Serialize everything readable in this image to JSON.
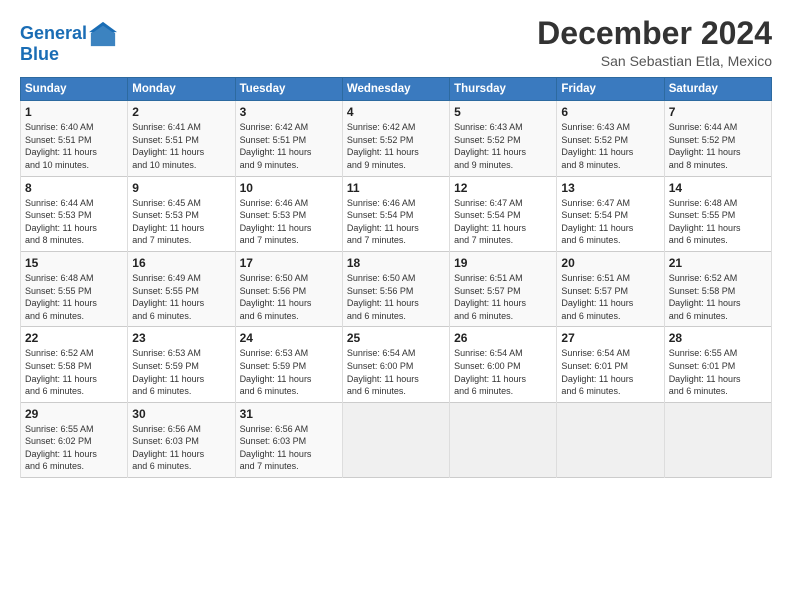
{
  "header": {
    "logo_line1": "General",
    "logo_line2": "Blue",
    "title": "December 2024",
    "location": "San Sebastian Etla, Mexico"
  },
  "weekdays": [
    "Sunday",
    "Monday",
    "Tuesday",
    "Wednesday",
    "Thursday",
    "Friday",
    "Saturday"
  ],
  "weeks": [
    [
      {
        "day": "1",
        "info": "Sunrise: 6:40 AM\nSunset: 5:51 PM\nDaylight: 11 hours\nand 10 minutes."
      },
      {
        "day": "2",
        "info": "Sunrise: 6:41 AM\nSunset: 5:51 PM\nDaylight: 11 hours\nand 10 minutes."
      },
      {
        "day": "3",
        "info": "Sunrise: 6:42 AM\nSunset: 5:51 PM\nDaylight: 11 hours\nand 9 minutes."
      },
      {
        "day": "4",
        "info": "Sunrise: 6:42 AM\nSunset: 5:52 PM\nDaylight: 11 hours\nand 9 minutes."
      },
      {
        "day": "5",
        "info": "Sunrise: 6:43 AM\nSunset: 5:52 PM\nDaylight: 11 hours\nand 9 minutes."
      },
      {
        "day": "6",
        "info": "Sunrise: 6:43 AM\nSunset: 5:52 PM\nDaylight: 11 hours\nand 8 minutes."
      },
      {
        "day": "7",
        "info": "Sunrise: 6:44 AM\nSunset: 5:52 PM\nDaylight: 11 hours\nand 8 minutes."
      }
    ],
    [
      {
        "day": "8",
        "info": "Sunrise: 6:44 AM\nSunset: 5:53 PM\nDaylight: 11 hours\nand 8 minutes."
      },
      {
        "day": "9",
        "info": "Sunrise: 6:45 AM\nSunset: 5:53 PM\nDaylight: 11 hours\nand 7 minutes."
      },
      {
        "day": "10",
        "info": "Sunrise: 6:46 AM\nSunset: 5:53 PM\nDaylight: 11 hours\nand 7 minutes."
      },
      {
        "day": "11",
        "info": "Sunrise: 6:46 AM\nSunset: 5:54 PM\nDaylight: 11 hours\nand 7 minutes."
      },
      {
        "day": "12",
        "info": "Sunrise: 6:47 AM\nSunset: 5:54 PM\nDaylight: 11 hours\nand 7 minutes."
      },
      {
        "day": "13",
        "info": "Sunrise: 6:47 AM\nSunset: 5:54 PM\nDaylight: 11 hours\nand 6 minutes."
      },
      {
        "day": "14",
        "info": "Sunrise: 6:48 AM\nSunset: 5:55 PM\nDaylight: 11 hours\nand 6 minutes."
      }
    ],
    [
      {
        "day": "15",
        "info": "Sunrise: 6:48 AM\nSunset: 5:55 PM\nDaylight: 11 hours\nand 6 minutes."
      },
      {
        "day": "16",
        "info": "Sunrise: 6:49 AM\nSunset: 5:55 PM\nDaylight: 11 hours\nand 6 minutes."
      },
      {
        "day": "17",
        "info": "Sunrise: 6:50 AM\nSunset: 5:56 PM\nDaylight: 11 hours\nand 6 minutes."
      },
      {
        "day": "18",
        "info": "Sunrise: 6:50 AM\nSunset: 5:56 PM\nDaylight: 11 hours\nand 6 minutes."
      },
      {
        "day": "19",
        "info": "Sunrise: 6:51 AM\nSunset: 5:57 PM\nDaylight: 11 hours\nand 6 minutes."
      },
      {
        "day": "20",
        "info": "Sunrise: 6:51 AM\nSunset: 5:57 PM\nDaylight: 11 hours\nand 6 minutes."
      },
      {
        "day": "21",
        "info": "Sunrise: 6:52 AM\nSunset: 5:58 PM\nDaylight: 11 hours\nand 6 minutes."
      }
    ],
    [
      {
        "day": "22",
        "info": "Sunrise: 6:52 AM\nSunset: 5:58 PM\nDaylight: 11 hours\nand 6 minutes."
      },
      {
        "day": "23",
        "info": "Sunrise: 6:53 AM\nSunset: 5:59 PM\nDaylight: 11 hours\nand 6 minutes."
      },
      {
        "day": "24",
        "info": "Sunrise: 6:53 AM\nSunset: 5:59 PM\nDaylight: 11 hours\nand 6 minutes."
      },
      {
        "day": "25",
        "info": "Sunrise: 6:54 AM\nSunset: 6:00 PM\nDaylight: 11 hours\nand 6 minutes."
      },
      {
        "day": "26",
        "info": "Sunrise: 6:54 AM\nSunset: 6:00 PM\nDaylight: 11 hours\nand 6 minutes."
      },
      {
        "day": "27",
        "info": "Sunrise: 6:54 AM\nSunset: 6:01 PM\nDaylight: 11 hours\nand 6 minutes."
      },
      {
        "day": "28",
        "info": "Sunrise: 6:55 AM\nSunset: 6:01 PM\nDaylight: 11 hours\nand 6 minutes."
      }
    ],
    [
      {
        "day": "29",
        "info": "Sunrise: 6:55 AM\nSunset: 6:02 PM\nDaylight: 11 hours\nand 6 minutes."
      },
      {
        "day": "30",
        "info": "Sunrise: 6:56 AM\nSunset: 6:03 PM\nDaylight: 11 hours\nand 6 minutes."
      },
      {
        "day": "31",
        "info": "Sunrise: 6:56 AM\nSunset: 6:03 PM\nDaylight: 11 hours\nand 7 minutes."
      },
      {
        "day": "",
        "info": ""
      },
      {
        "day": "",
        "info": ""
      },
      {
        "day": "",
        "info": ""
      },
      {
        "day": "",
        "info": ""
      }
    ]
  ]
}
